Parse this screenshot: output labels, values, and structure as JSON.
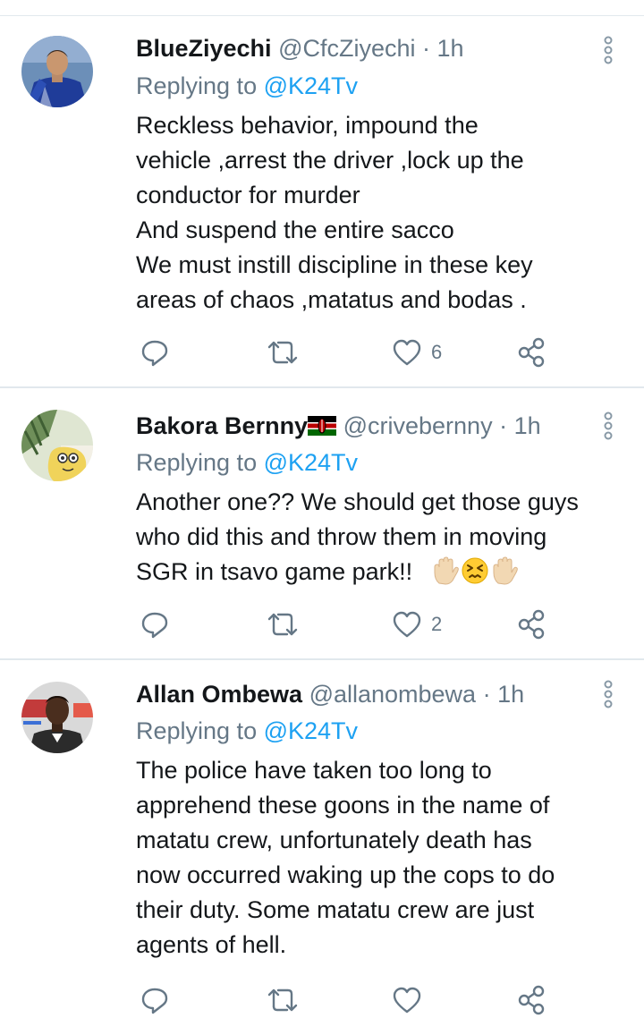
{
  "tweets": [
    {
      "name": "BlueZiyechi",
      "handle": "@CfcZiyechi",
      "time": "1h",
      "replying_prefix": "Replying to ",
      "replying_to": "@K24Tv",
      "text_lines": [
        "Reckless behavior, impound the",
        "vehicle ,arrest the driver ,lock up the",
        "conductor for murder",
        "And suspend the entire sacco",
        "We must instill discipline in these key",
        "areas of chaos ,matatus and bodas  ."
      ],
      "likes": "6"
    },
    {
      "name": "Bakora Bernny",
      "name_emoji": "kenya-flag",
      "handle": "@crivebernny",
      "time": "1h",
      "replying_prefix": "Replying to ",
      "replying_to": "@K24Tv",
      "text_lines": [
        "Another one?? We should get those guys",
        "who did this and throw them in moving",
        "SGR in tsavo game park!!"
      ],
      "text_emojis": [
        "raised-hand",
        "persevering-face",
        "raised-hand"
      ],
      "likes": "2"
    },
    {
      "name": "Allan Ombewa",
      "handle": "@allanombewa",
      "time": "1h",
      "replying_prefix": "Replying to ",
      "replying_to": "@K24Tv",
      "text_lines": [
        "The police have taken too long to",
        "apprehend these goons in the name of",
        "matatu crew, unfortunately death has",
        "now occurred waking up the cops to do",
        "their duty. Some matatu crew are just",
        "agents of hell."
      ],
      "likes": ""
    }
  ],
  "icons": [
    "reply-icon",
    "retweet-icon",
    "like-icon",
    "share-icon",
    "more-options-icon"
  ],
  "colors": {
    "text": "#14171a",
    "secondary": "#657786",
    "link": "#1da1f2",
    "divider": "#e1e8ed"
  }
}
